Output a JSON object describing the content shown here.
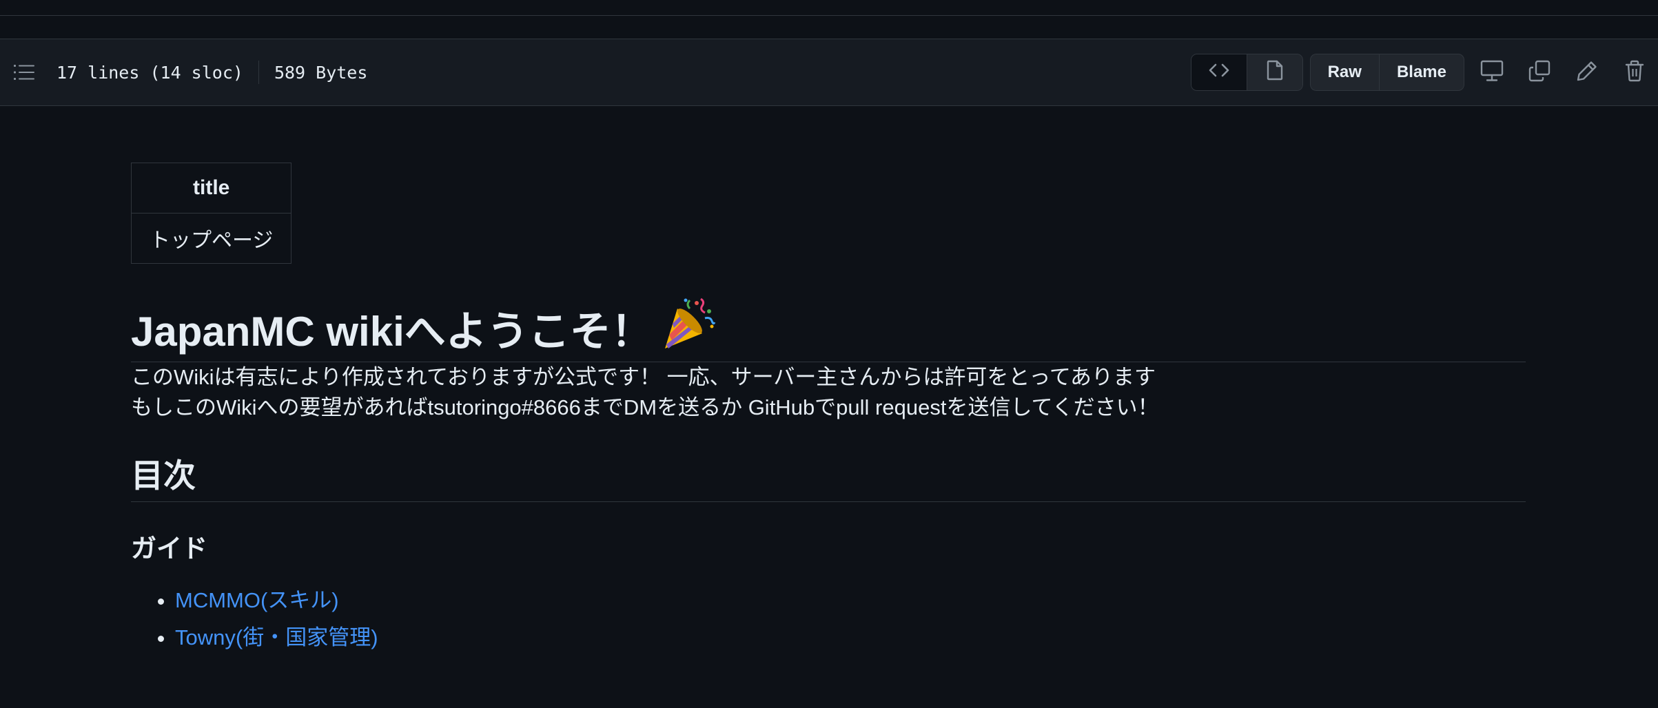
{
  "file_header": {
    "lines_info": "17 lines (14 sloc)",
    "size": "589 Bytes",
    "raw_label": "Raw",
    "blame_label": "Blame",
    "icons": [
      "list-unordered-icon",
      "code-icon",
      "file-icon",
      "desktop-icon",
      "copy-icon",
      "pencil-icon",
      "trash-icon"
    ]
  },
  "front_matter": {
    "header": "title",
    "value": "トップページ"
  },
  "readme": {
    "title": "JapanMC wikiへようこそ！",
    "title_emoji": "party-popper",
    "paragraph1": "このWikiは有志により作成されておりますが公式です！ 一応、サーバー主さんからは許可をとってあります",
    "paragraph2": "もしこのWikiへの要望があればtsutoringo#8666までDMを送るか GitHubでpull requestを送信してください！",
    "toc_heading": "目次",
    "guide_heading": "ガイド",
    "guide_items": [
      "MCMMO(スキル)",
      "Towny(街・国家管理)"
    ]
  },
  "colors": {
    "background": "#0d1117",
    "header_bg": "#161b22",
    "border": "#30363d",
    "text": "#e6edf3",
    "link": "#4493f8"
  }
}
